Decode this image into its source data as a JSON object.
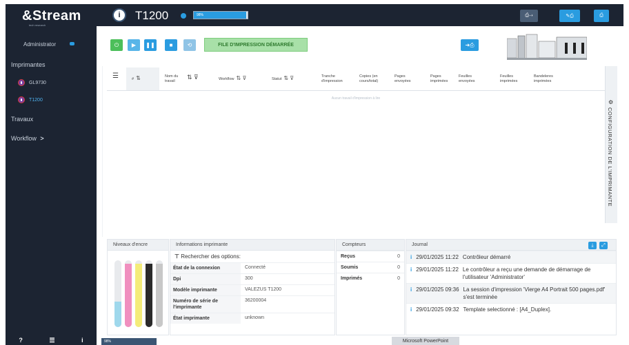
{
  "sidebar": {
    "brand": "&Stream",
    "brand_sub": "tech research",
    "user": "Administrator",
    "printers_heading": "Imprimantes",
    "printers": [
      {
        "label": "GL9730",
        "active": false
      },
      {
        "label": "T1200",
        "active": true
      }
    ],
    "jobs_heading": "Travaux",
    "workflow_heading": "Workflow",
    "workflow_arrow": ">",
    "footer": {
      "help": "?",
      "menu": "☰",
      "info": "i"
    }
  },
  "topbar": {
    "title": "T1200",
    "logo_letter": "i",
    "progress_label": "98%",
    "progress_fraction": 0.98,
    "buttons": [
      "",
      "",
      ""
    ]
  },
  "toolbar": {
    "queue_status": "FILE D'IMPRESSION DÉMARRÉE",
    "power_icon": "power-icon",
    "play_icon": "play-icon",
    "pause_icon": "pause-icon",
    "stop_icon": "stop-icon",
    "recycle_icon": "recycle-icon",
    "send_icon": "send-to-printer-icon"
  },
  "jobs_table": {
    "columns": [
      {
        "label": "#",
        "sort": true,
        "filter": false
      },
      {
        "label": "Nom du travail",
        "sort": true,
        "filter": true
      },
      {
        "label": "Workflow",
        "sort": true,
        "filter": true
      },
      {
        "label": "Statut",
        "sort": true,
        "filter": true
      },
      {
        "label": "Tranche d'impression",
        "sort": false,
        "filter": false
      },
      {
        "label": "Copies (en cours/total)",
        "sort": false,
        "filter": false
      },
      {
        "label": "Pages envoyées",
        "sort": false,
        "filter": false
      },
      {
        "label": "Pages imprimées",
        "sort": false,
        "filter": false
      },
      {
        "label": "Feuilles envoyées",
        "sort": false,
        "filter": false
      },
      {
        "label": "Feuilles imprimées",
        "sort": false,
        "filter": false
      },
      {
        "label": "Bandeleres imprimées",
        "sort": false,
        "filter": false
      }
    ],
    "empty_text": "Aucun travail d'impression à lire"
  },
  "config_tab": {
    "label": "CONFIGURATION DE L'IMPRIMANTE"
  },
  "ink_panel": {
    "title": "Niveaux d'encre",
    "inks": [
      {
        "name": "cyan",
        "level": 0.38,
        "color": "#9fd8ec"
      },
      {
        "name": "magenta",
        "level": 0.95,
        "color": "#f08fbf"
      },
      {
        "name": "yellow",
        "level": 0.95,
        "color": "#f4ec7a"
      },
      {
        "name": "black",
        "level": 0.95,
        "color": "#2a2a2a"
      },
      {
        "name": "extra",
        "level": 0.95,
        "color": "#c8c8c8"
      }
    ]
  },
  "info_panel": {
    "title": "Informations imprimante",
    "search_placeholder": "Rechercher des options:",
    "rows": [
      {
        "key": "État de la connexion",
        "value": "Connecté"
      },
      {
        "key": "Dpi",
        "value": "300"
      },
      {
        "key": "Modèle imprimante",
        "value": "VALEZUS T1200"
      },
      {
        "key": "Numéro de série de l'imprimante",
        "value": "36200004"
      },
      {
        "key": "État imprimante",
        "value": "unknown"
      }
    ]
  },
  "counters_panel": {
    "title": "Compteurs",
    "rows": [
      {
        "label": "Reçus",
        "value": "0"
      },
      {
        "label": "Soumis",
        "value": "0"
      },
      {
        "label": "Imprimés",
        "value": "0"
      }
    ]
  },
  "journal_panel": {
    "title": "Journal",
    "entries": [
      {
        "time": "29/01/2025 11:22",
        "text": "Contrôleur démarré"
      },
      {
        "time": "29/01/2025 11:22",
        "text": "Le contrôleur a reçu une demande de démarrage de l'utilisateur 'Administrator'"
      },
      {
        "time": "29/01/2025 09:36",
        "text": "La session d'impression 'Vierge A4 Portrait 500 pages.pdf' s'est terminée"
      },
      {
        "time": "29/01/2025 09:32",
        "text": "Template selectionné : [A4_Duplex]."
      }
    ]
  },
  "taskbar": {
    "left_label": "98%",
    "middle_label": "Microsoft PowerPoint"
  },
  "colors": {
    "sidebar_bg": "#1c2432",
    "accent_blue": "#2a9ce0",
    "success_green": "#4cbf5a",
    "queue_green": "#a8e0a8"
  }
}
